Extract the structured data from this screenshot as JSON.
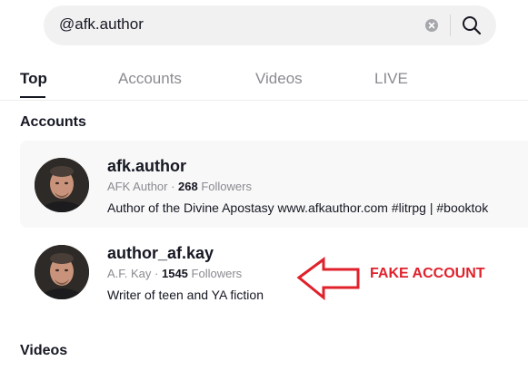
{
  "search": {
    "query": "@afk.author"
  },
  "tabs": [
    {
      "label": "Top",
      "active": true
    },
    {
      "label": "Accounts",
      "active": false
    },
    {
      "label": "Videos",
      "active": false
    },
    {
      "label": "LIVE",
      "active": false
    }
  ],
  "sections": {
    "accounts": "Accounts",
    "videos": "Videos"
  },
  "accounts": [
    {
      "username": "afk.author",
      "display_name": "AFK Author",
      "sep": " · ",
      "followers": "268",
      "followers_label": " Followers",
      "bio": "Author of the Divine Apostasy www.afkauthor.com #litrpg | #booktok"
    },
    {
      "username": "author_af.kay",
      "display_name": "A.F. Kay",
      "sep": " · ",
      "followers": "1545",
      "followers_label": " Followers",
      "bio": "Writer of teen and YA fiction"
    }
  ],
  "annotation": {
    "label": "FAKE ACCOUNT",
    "color": "#e0212b"
  },
  "icons": {
    "clear": "clear-icon",
    "search": "search-icon",
    "arrow": "left-arrow-icon"
  }
}
